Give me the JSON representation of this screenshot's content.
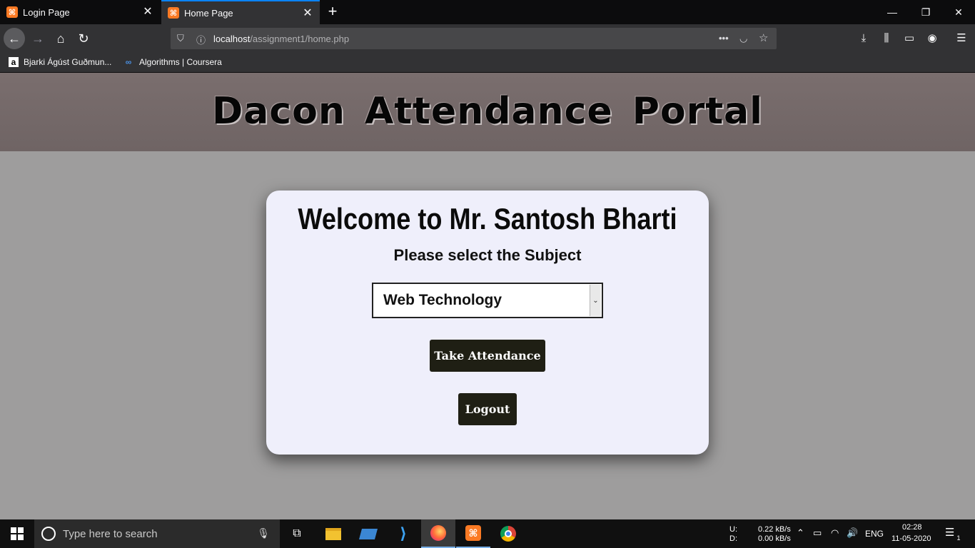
{
  "browser": {
    "tabs": [
      {
        "title": "Login Page"
      },
      {
        "title": "Home Page"
      }
    ],
    "url_host": "localhost",
    "url_path": "/assignment1/home.php",
    "bookmarks": [
      {
        "label": "Bjarki Ágúst Guðmun..."
      },
      {
        "label": "Algorithms | Coursera"
      }
    ]
  },
  "page": {
    "title": "Dacon Attendance Portal",
    "welcome": "Welcome to Mr. Santosh Bharti",
    "subject_prompt": "Please select the Subject",
    "subject_selected": "Web Technology",
    "take_attendance_label": "Take Attendance",
    "logout_label": "Logout"
  },
  "taskbar": {
    "search_placeholder": "Type here to search",
    "net_up_label": "U:",
    "net_down_label": "D:",
    "net_up": "0.22 kB/s",
    "net_down": "0.00 kB/s",
    "language": "ENG",
    "time": "02:28",
    "date": "11-05-2020",
    "notification_count": "1"
  },
  "colors": {
    "banner": "#766a6a",
    "page_bg": "#9e9d9d",
    "card_bg": "#efeffb",
    "button_bg": "#1f1f14",
    "accent": "#0a84ff"
  }
}
